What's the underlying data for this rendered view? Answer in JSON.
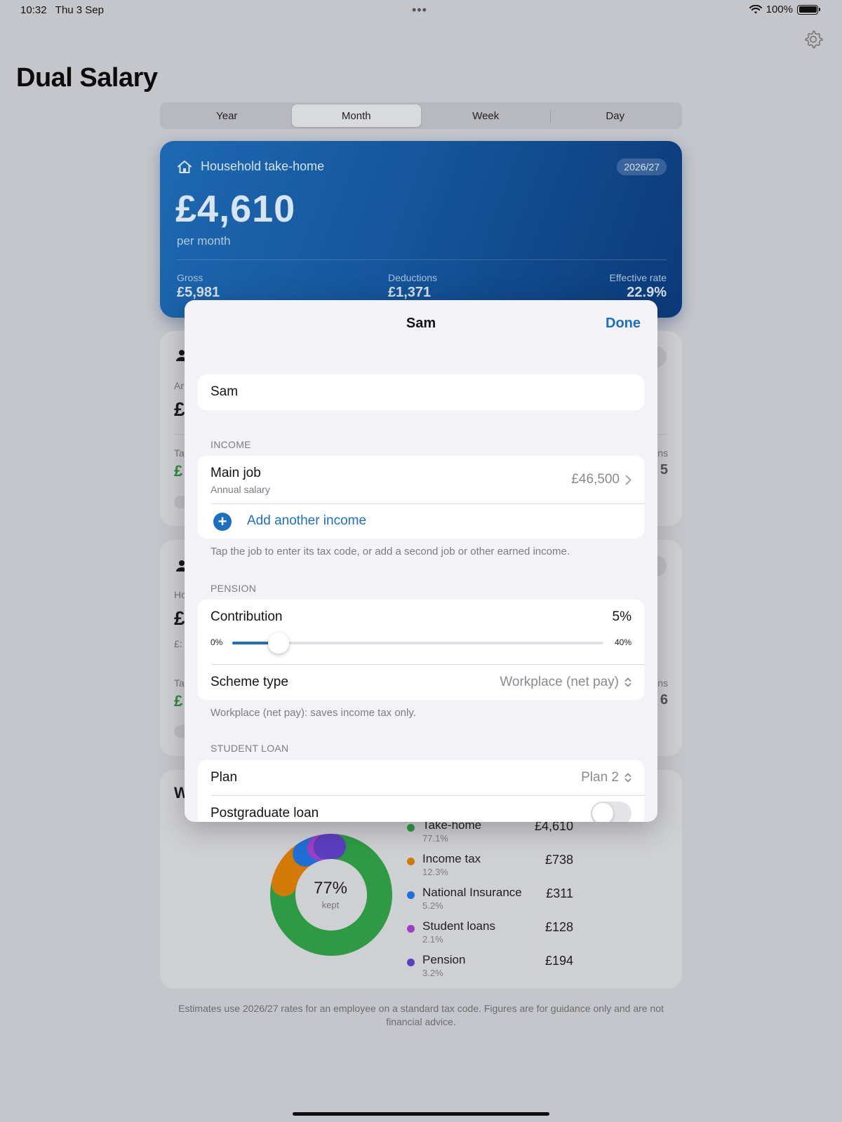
{
  "status": {
    "time": "10:32",
    "date": "Thu 3 Sep",
    "battery": "100%"
  },
  "app": {
    "title": "Dual Salary"
  },
  "period_tabs": [
    {
      "label": "Year",
      "active": false
    },
    {
      "label": "Month",
      "active": true
    },
    {
      "label": "Week",
      "active": false
    },
    {
      "label": "Day",
      "active": false
    }
  ],
  "hero": {
    "title": "Household take-home",
    "tax_year": "2026/27",
    "amount": "£4,610",
    "period": "per month",
    "stats": [
      {
        "label": "Gross",
        "value": "£5,981"
      },
      {
        "label": "Deductions",
        "value": "£1,371"
      },
      {
        "label": "Effective rate",
        "value": "22.9%"
      }
    ]
  },
  "card1_peek": {
    "a": "Ar",
    "b": "£",
    "c": "Ta",
    "d": "£",
    "e": "ns",
    "f": "5"
  },
  "card2_peek": {
    "a": "Hc",
    "b": "£",
    "c": "£:",
    "d": "Ta",
    "e": "£",
    "f": "ns",
    "g": "6"
  },
  "breakdown": {
    "title_peek": "W",
    "center_pct": "77%",
    "center_label": "kept",
    "items": [
      {
        "name": "Take-home",
        "pct": "77.1%",
        "value": "£4,610",
        "color": "#2e9b44"
      },
      {
        "name": "Income tax",
        "pct": "12.3%",
        "value": "£738",
        "color": "#d37a06"
      },
      {
        "name": "National Insurance",
        "pct": "5.2%",
        "value": "£311",
        "color": "#1f6fd6"
      },
      {
        "name": "Student loans",
        "pct": "2.1%",
        "value": "£128",
        "color": "#9d3fc5"
      },
      {
        "name": "Pension",
        "pct": "3.2%",
        "value": "£194",
        "color": "#5a3fc0"
      }
    ]
  },
  "footnote": "Estimates use 2026/27 rates for an employee on a standard tax code. Figures are for guidance only and are not financial advice.",
  "sheet": {
    "title": "Sam",
    "done_label": "Done",
    "name_value": "Sam",
    "income": {
      "header": "INCOME",
      "job_title": "Main job",
      "job_sub": "Annual salary",
      "job_value": "£46,500",
      "add_label": "Add another income",
      "footer": "Tap the job to enter its tax code, or add a second job or other earned income."
    },
    "pension": {
      "header": "PENSION",
      "contribution_label": "Contribution",
      "contribution_value": "5%",
      "contribution_fraction": 0.125,
      "slider_min": "0%",
      "slider_max": "40%",
      "scheme_label": "Scheme type",
      "scheme_value": "Workplace (net pay)",
      "footer": "Workplace (net pay): saves income tax only."
    },
    "student_loan": {
      "header": "STUDENT LOAN",
      "plan_label": "Plan",
      "plan_value": "Plan 2",
      "postgrad_label": "Postgraduate loan",
      "postgrad_on": false
    }
  }
}
